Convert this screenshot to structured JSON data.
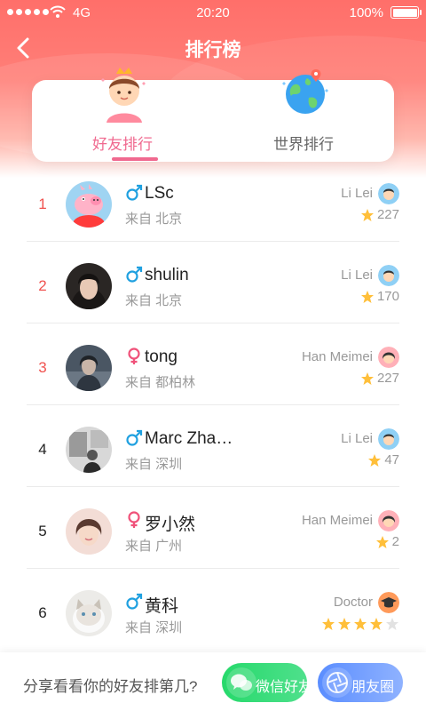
{
  "status_bar": {
    "carrier": "4G",
    "time": "20:20",
    "battery": "100%"
  },
  "nav": {
    "title": "排行榜"
  },
  "tabs": [
    {
      "label": "好友排行",
      "active": true
    },
    {
      "label": "世界排行",
      "active": false
    }
  ],
  "ranks": [
    {
      "rank": "1",
      "gender": "male",
      "gender_symbol": "♂",
      "name": "LSc",
      "from": "来自 北京",
      "partner": "Li Lei",
      "score": "227",
      "stars": null
    },
    {
      "rank": "2",
      "gender": "male",
      "gender_symbol": "♂",
      "name": "shulin",
      "from": "来自 北京",
      "partner": "Li Lei",
      "score": "170",
      "stars": null
    },
    {
      "rank": "3",
      "gender": "female",
      "gender_symbol": "♀",
      "name": "tong",
      "from": "来自 都柏林",
      "partner": "Han Meimei",
      "score": "227",
      "stars": null
    },
    {
      "rank": "4",
      "gender": "male",
      "gender_symbol": "♂",
      "name": "Marc Zha…",
      "from": "来自 深圳",
      "partner": "Li Lei",
      "score": "47",
      "stars": null
    },
    {
      "rank": "5",
      "gender": "female",
      "gender_symbol": "♀",
      "name": "罗小然",
      "from": "来自 广州",
      "partner": "Han Meimei",
      "score": "2",
      "stars": null
    },
    {
      "rank": "6",
      "gender": "male",
      "gender_symbol": "♂",
      "name": "黄科",
      "from": "来自 深圳",
      "partner": "Doctor",
      "score": null,
      "stars": 4
    }
  ],
  "bottom": {
    "prompt": "分享看看你的好友排第几?",
    "wechat_label": "微信好友",
    "moments_label": "朋友圈"
  },
  "colors": {
    "header_red": "#ff6f6a",
    "accent_pink": "#f0698f",
    "rank_top_red": "#f0524f",
    "male_blue": "#1fa0e0",
    "female_pink": "#f0527a",
    "star_gold": "#ffbf3a",
    "wechat_green": "#26d96b",
    "moments_blue": "#5a8dff"
  }
}
